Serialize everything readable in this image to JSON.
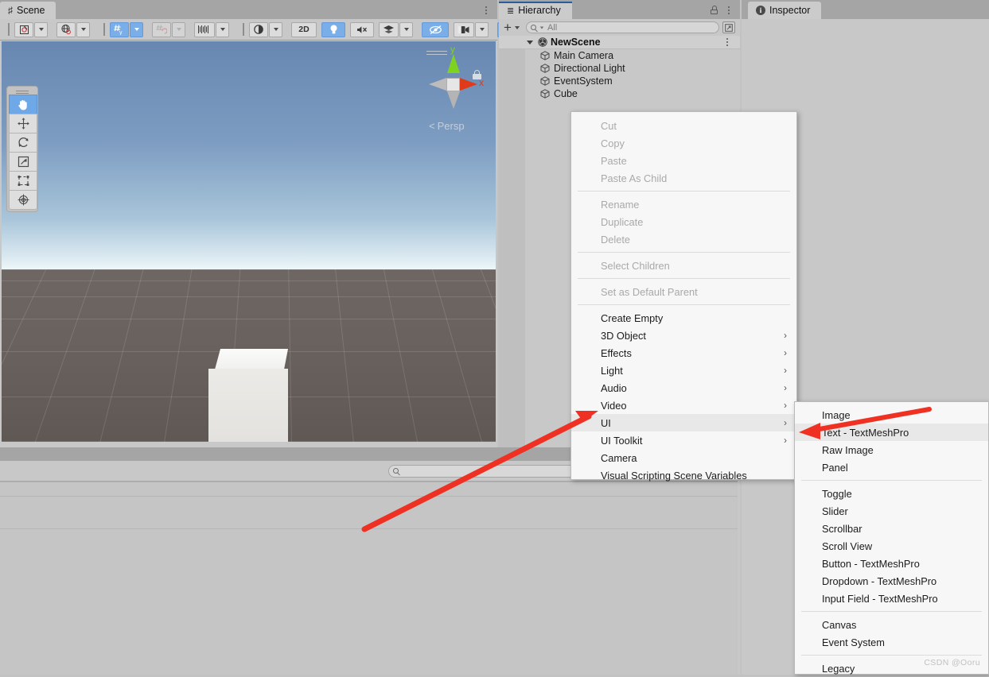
{
  "scene_panel": {
    "tab_label": "Scene",
    "tab_icon": "grid-hash-icon",
    "gizmo": {
      "axis_y": "y",
      "axis_x": "x",
      "projection_label": "Persp"
    },
    "toolbar": {
      "pivot_button": "pivot-toggle",
      "handle_button": "global-local-toggle",
      "grid_snap_button": "grid-snapping",
      "vertex_snap_button": "vertex-snapping",
      "layout_button": "grid-visibility",
      "draw_mode": "shading-mode",
      "button_2d": "2D",
      "lighting_button": "scene-lighting",
      "audio_button": "scene-audio",
      "fx_button": "effects",
      "hidden_button": "hidden-objects",
      "camera_button": "scene-camera",
      "gizmos_button": "gizmos"
    },
    "tools": [
      {
        "name": "hand-tool",
        "selected": true
      },
      {
        "name": "move-tool",
        "selected": false
      },
      {
        "name": "rotate-tool",
        "selected": false
      },
      {
        "name": "scale-tool",
        "selected": false
      },
      {
        "name": "rect-transform-tool",
        "selected": false
      },
      {
        "name": "transform-tool",
        "selected": false
      }
    ]
  },
  "hierarchy_panel": {
    "tab_label": "Hierarchy",
    "tab_icon": "list-icon",
    "add_label": "+",
    "search_placeholder": "All",
    "scene_name": "NewScene",
    "objects": [
      {
        "label": "Main Camera"
      },
      {
        "label": "Directional Light"
      },
      {
        "label": "EventSystem"
      },
      {
        "label": "Cube"
      }
    ]
  },
  "inspector_panel": {
    "tab_label": "Inspector",
    "tab_icon": "info-icon"
  },
  "project_panel": {
    "search_placeholder": ""
  },
  "context_menu": {
    "items": [
      {
        "label": "Cut",
        "disabled": true,
        "submenu": false
      },
      {
        "label": "Copy",
        "disabled": true,
        "submenu": false
      },
      {
        "label": "Paste",
        "disabled": true,
        "submenu": false
      },
      {
        "label": "Paste As Child",
        "disabled": true,
        "submenu": false
      },
      {
        "separator": true
      },
      {
        "label": "Rename",
        "disabled": true,
        "submenu": false
      },
      {
        "label": "Duplicate",
        "disabled": true,
        "submenu": false
      },
      {
        "label": "Delete",
        "disabled": true,
        "submenu": false
      },
      {
        "separator": true
      },
      {
        "label": "Select Children",
        "disabled": true,
        "submenu": false
      },
      {
        "separator": true
      },
      {
        "label": "Set as Default Parent",
        "disabled": true,
        "submenu": false
      },
      {
        "separator": true
      },
      {
        "label": "Create Empty",
        "disabled": false,
        "submenu": false
      },
      {
        "label": "3D Object",
        "disabled": false,
        "submenu": true
      },
      {
        "label": "Effects",
        "disabled": false,
        "submenu": true
      },
      {
        "label": "Light",
        "disabled": false,
        "submenu": true
      },
      {
        "label": "Audio",
        "disabled": false,
        "submenu": true
      },
      {
        "label": "Video",
        "disabled": false,
        "submenu": true
      },
      {
        "label": "UI",
        "disabled": false,
        "submenu": true,
        "hover": true
      },
      {
        "label": "UI Toolkit",
        "disabled": false,
        "submenu": true
      },
      {
        "label": "Camera",
        "disabled": false,
        "submenu": false
      },
      {
        "label": "Visual Scripting Scene Variables",
        "disabled": false,
        "submenu": false
      }
    ]
  },
  "sub_menu": {
    "items": [
      {
        "label": "Image",
        "disabled": false
      },
      {
        "label": "Text - TextMeshPro",
        "disabled": false,
        "hover": true
      },
      {
        "label": "Raw Image",
        "disabled": false
      },
      {
        "label": "Panel",
        "disabled": false
      },
      {
        "separator": true
      },
      {
        "label": "Toggle",
        "disabled": false
      },
      {
        "label": "Slider",
        "disabled": false
      },
      {
        "label": "Scrollbar",
        "disabled": false
      },
      {
        "label": "Scroll View",
        "disabled": false
      },
      {
        "label": "Button - TextMeshPro",
        "disabled": false
      },
      {
        "label": "Dropdown - TextMeshPro",
        "disabled": false
      },
      {
        "label": "Input Field - TextMeshPro",
        "disabled": false
      },
      {
        "separator": true
      },
      {
        "label": "Canvas",
        "disabled": false
      },
      {
        "label": "Event System",
        "disabled": false
      },
      {
        "separator": true
      },
      {
        "label": "Legacy",
        "disabled": false
      }
    ]
  },
  "annotations": {
    "arrow_color": "#ef3124",
    "arrow_1_target": "UI",
    "arrow_2_target": "Text - TextMeshPro"
  },
  "watermark": "CSDN @Ooru"
}
